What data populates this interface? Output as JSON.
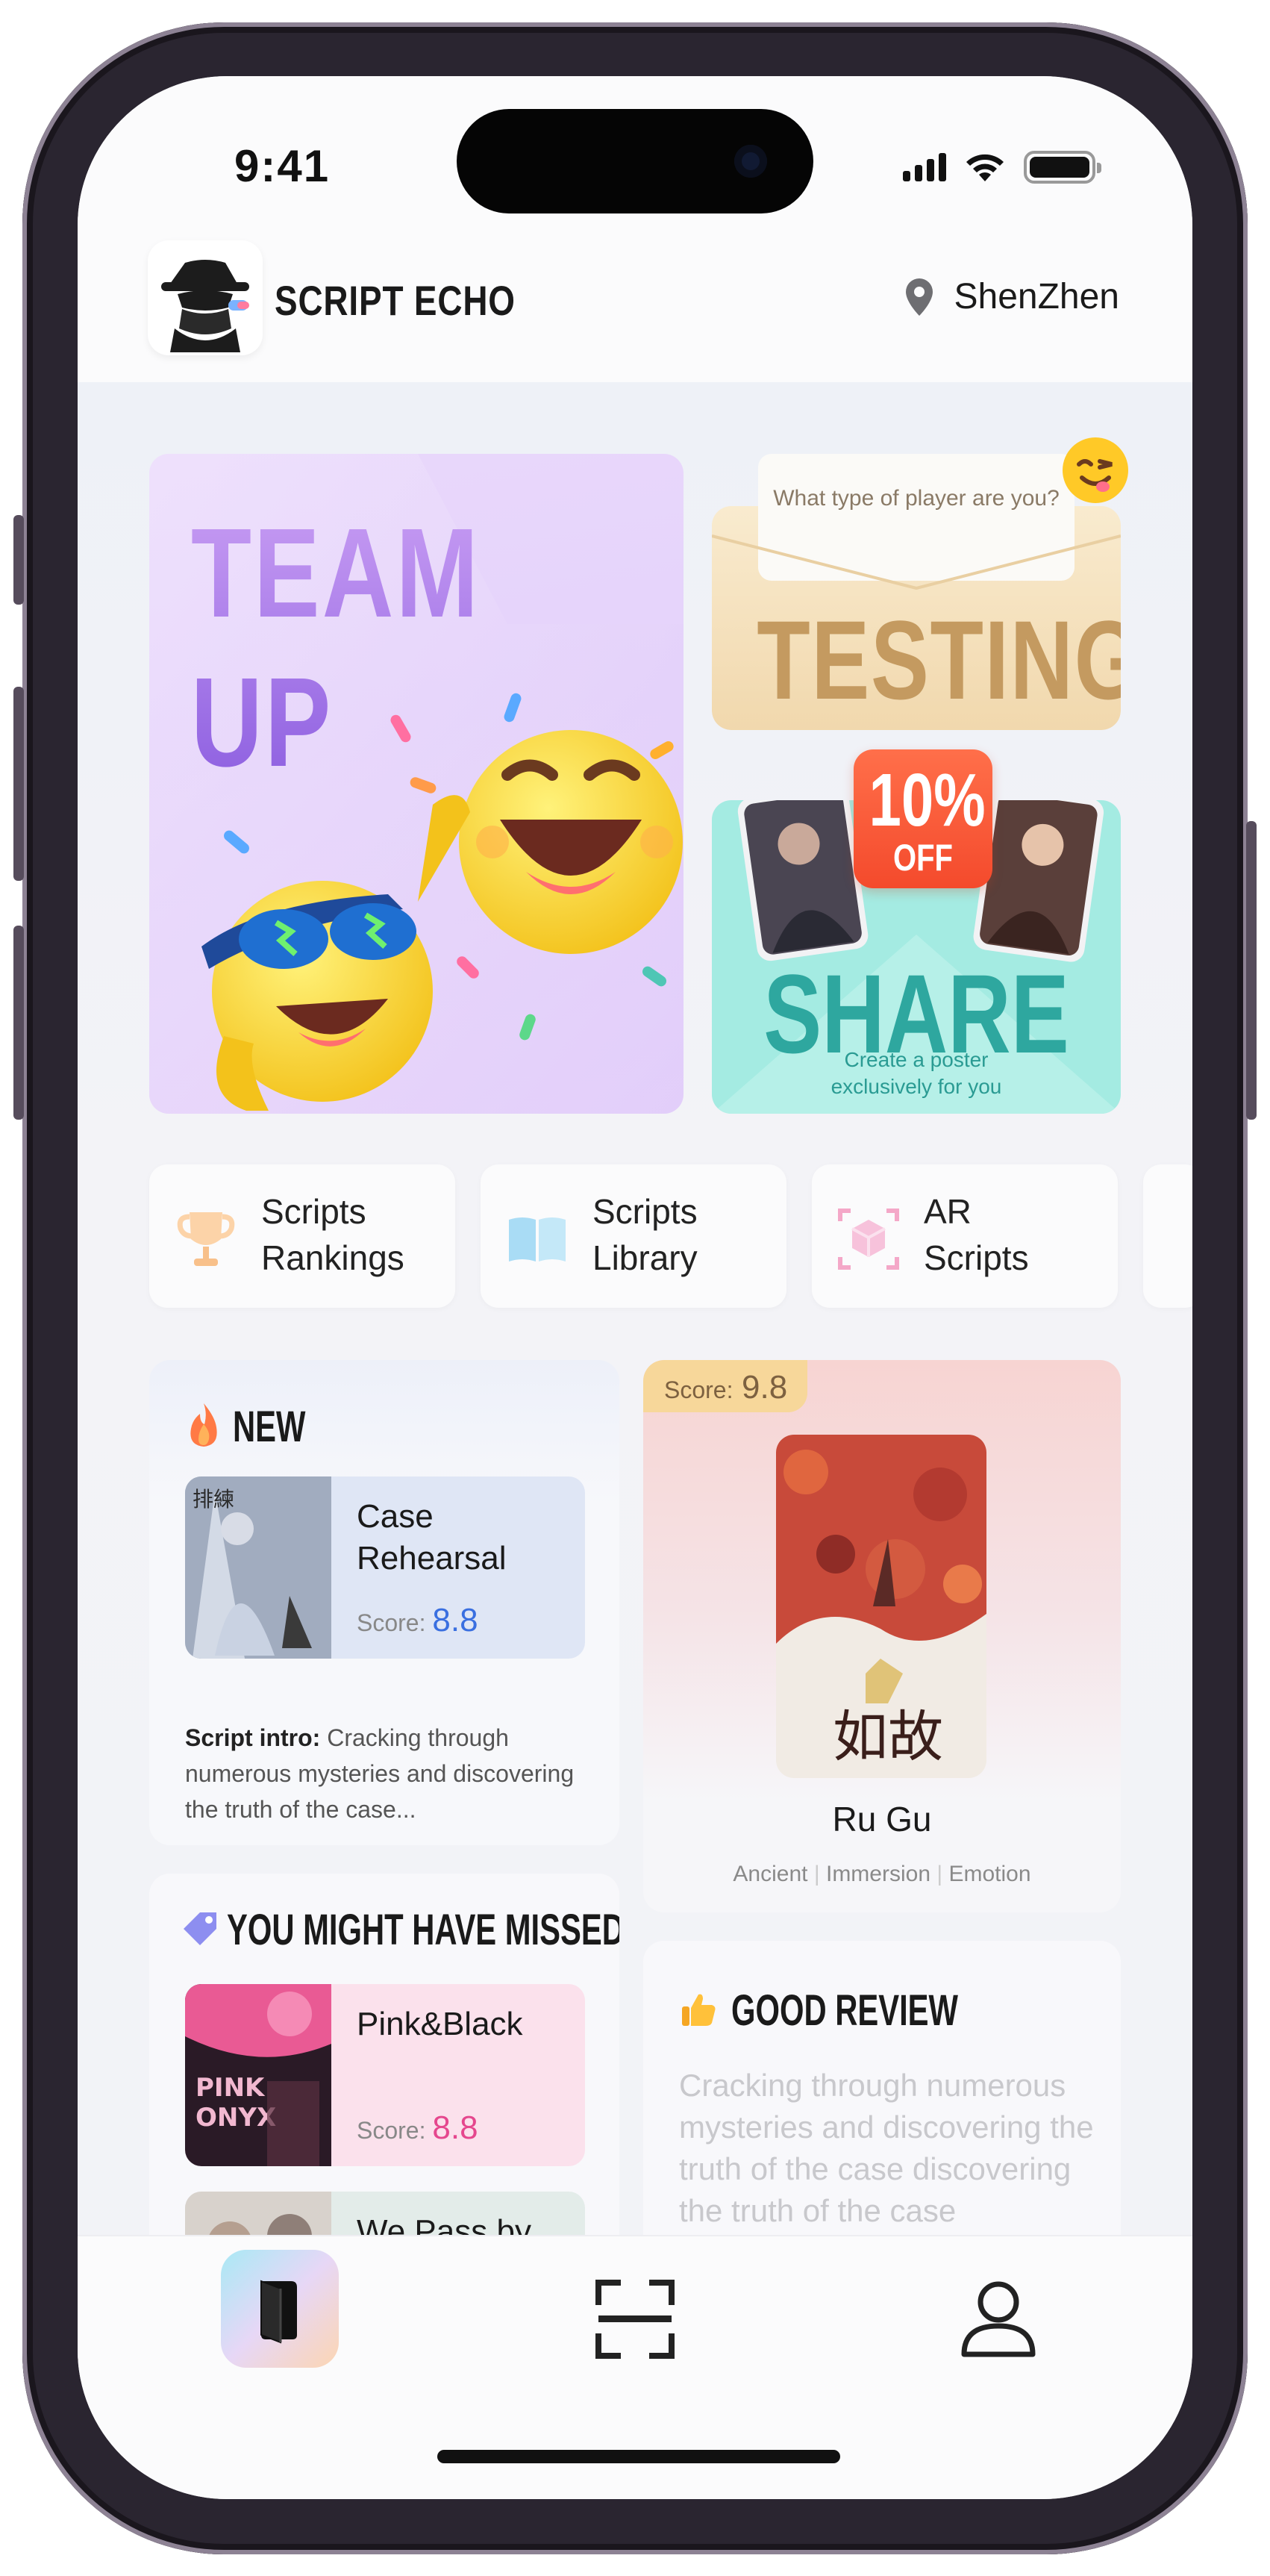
{
  "status_bar": {
    "time": "9:41"
  },
  "header": {
    "brand": "SCRIPT ECHO",
    "location": "ShenZhen",
    "logo_icon": "detective-logo-icon",
    "location_icon": "map-pin-icon"
  },
  "banners": {
    "team_up": {
      "title_line1": "TEAM",
      "title_line2": "UP"
    },
    "testing": {
      "question": "What type of player are you?",
      "title": "TESTING"
    },
    "share": {
      "discount_pct": "10%",
      "discount_off": "OFF",
      "title": "SHARE",
      "subtitle_line1": "Create a poster",
      "subtitle_line2": "exclusively for you"
    }
  },
  "quick_links": [
    {
      "line1": "Scripts",
      "line2": "Rankings",
      "icon": "trophy-icon"
    },
    {
      "line1": "Scripts",
      "line2": "Library",
      "icon": "book-icon"
    },
    {
      "line1": "AR",
      "line2": "Scripts",
      "icon": "ar-cube-icon"
    }
  ],
  "new_section": {
    "heading": "NEW",
    "item": {
      "title": "Case Rehearsal",
      "score_label": "Score:",
      "score": "8.8"
    },
    "intro_label": "Script intro:",
    "intro_text": " Cracking through numerous mysteries and discovering the truth of the case..."
  },
  "featured": {
    "score_label": "Score:",
    "score": "9.8",
    "title": "Ru Gu",
    "tags": [
      "Ancient",
      "Immersion",
      "Emotion"
    ]
  },
  "missed_section": {
    "heading": "YOU MIGHT HAVE MISSED",
    "items": [
      {
        "title": "Pink&Black",
        "score_label": "Score:",
        "score": "8.8"
      },
      {
        "title": "We Pass by"
      }
    ]
  },
  "good_review": {
    "heading": "GOOD REVIEW",
    "text": "Cracking through numerous mysteries and discovering the truth of the case discovering the truth of the case"
  },
  "tab_bar": [
    {
      "name": "home",
      "icon": "book-tab-icon",
      "active": true
    },
    {
      "name": "scan",
      "icon": "scan-icon",
      "active": false
    },
    {
      "name": "profile",
      "icon": "user-icon",
      "active": false
    }
  ],
  "colors": {
    "team_purple": "#a777e8",
    "testing_gold": "#c49a60",
    "share_teal": "#2ea79f",
    "discount_red": "#f44a2c",
    "score_blue": "#3a6fe0",
    "score_pink": "#e5478e"
  }
}
